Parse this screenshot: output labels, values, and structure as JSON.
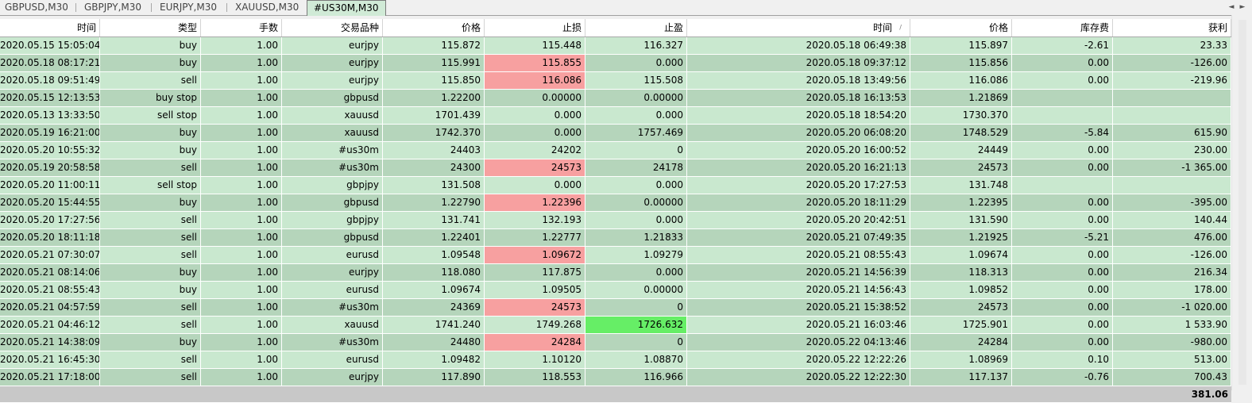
{
  "tabs": [
    {
      "label": "GBPUSD,M30",
      "active": false
    },
    {
      "label": "GBPJPY,M30",
      "active": false
    },
    {
      "label": "EURJPY,M30",
      "active": false
    },
    {
      "label": "XAUUSD,M30",
      "active": false
    },
    {
      "label": "#US30M,M30",
      "active": true
    }
  ],
  "nav": {
    "left": "◄",
    "right": "►"
  },
  "columns": [
    "时间",
    "类型",
    "手数",
    "交易品种",
    "价格",
    "止损",
    "止盈",
    "时间",
    "价格",
    "库存费",
    "获利"
  ],
  "sort_indicator": "/",
  "rows": [
    {
      "open_time": "2020.05.15 15:05:04",
      "type": "buy",
      "lots": "1.00",
      "symbol": "eurjpy",
      "price": "115.872",
      "sl": "115.448",
      "tp": "116.327",
      "close_time": "2020.05.18 06:49:38",
      "close_price": "115.897",
      "swap": "-2.61",
      "profit": "23.33"
    },
    {
      "open_time": "2020.05.18 08:17:21",
      "type": "buy",
      "lots": "1.00",
      "symbol": "eurjpy",
      "price": "115.991",
      "sl": "115.855",
      "tp": "0.000",
      "close_time": "2020.05.18 09:37:12",
      "close_price": "115.856",
      "swap": "0.00",
      "profit": "-126.00",
      "sl_hit": true
    },
    {
      "open_time": "2020.05.18 09:51:49",
      "type": "sell",
      "lots": "1.00",
      "symbol": "eurjpy",
      "price": "115.850",
      "sl": "116.086",
      "tp": "115.508",
      "close_time": "2020.05.18 13:49:56",
      "close_price": "116.086",
      "swap": "0.00",
      "profit": "-219.96",
      "sl_hit": true
    },
    {
      "open_time": "2020.05.15 12:13:53",
      "type": "buy stop",
      "lots": "1.00",
      "symbol": "gbpusd",
      "price": "1.22200",
      "sl": "0.00000",
      "tp": "0.00000",
      "close_time": "2020.05.18 16:13:53",
      "close_price": "1.21869",
      "swap": "",
      "profit": ""
    },
    {
      "open_time": "2020.05.13 13:33:50",
      "type": "sell stop",
      "lots": "1.00",
      "symbol": "xauusd",
      "price": "1701.439",
      "sl": "0.000",
      "tp": "0.000",
      "close_time": "2020.05.18 18:54:20",
      "close_price": "1730.370",
      "swap": "",
      "profit": ""
    },
    {
      "open_time": "2020.05.19 16:21:00",
      "type": "buy",
      "lots": "1.00",
      "symbol": "xauusd",
      "price": "1742.370",
      "sl": "0.000",
      "tp": "1757.469",
      "close_time": "2020.05.20 06:08:20",
      "close_price": "1748.529",
      "swap": "-5.84",
      "profit": "615.90"
    },
    {
      "open_time": "2020.05.20 10:55:32",
      "type": "buy",
      "lots": "1.00",
      "symbol": "#us30m",
      "price": "24403",
      "sl": "24202",
      "tp": "0",
      "close_time": "2020.05.20 16:00:52",
      "close_price": "24449",
      "swap": "0.00",
      "profit": "230.00"
    },
    {
      "open_time": "2020.05.19 20:58:58",
      "type": "sell",
      "lots": "1.00",
      "symbol": "#us30m",
      "price": "24300",
      "sl": "24573",
      "tp": "24178",
      "close_time": "2020.05.20 16:21:13",
      "close_price": "24573",
      "swap": "0.00",
      "profit": "-1 365.00",
      "sl_hit": true
    },
    {
      "open_time": "2020.05.20 11:00:11",
      "type": "sell stop",
      "lots": "1.00",
      "symbol": "gbpjpy",
      "price": "131.508",
      "sl": "0.000",
      "tp": "0.000",
      "close_time": "2020.05.20 17:27:53",
      "close_price": "131.748",
      "swap": "",
      "profit": ""
    },
    {
      "open_time": "2020.05.20 15:44:55",
      "type": "buy",
      "lots": "1.00",
      "symbol": "gbpusd",
      "price": "1.22790",
      "sl": "1.22396",
      "tp": "0.00000",
      "close_time": "2020.05.20 18:11:29",
      "close_price": "1.22395",
      "swap": "0.00",
      "profit": "-395.00",
      "sl_hit": true
    },
    {
      "open_time": "2020.05.20 17:27:56",
      "type": "sell",
      "lots": "1.00",
      "symbol": "gbpjpy",
      "price": "131.741",
      "sl": "132.193",
      "tp": "0.000",
      "close_time": "2020.05.20 20:42:51",
      "close_price": "131.590",
      "swap": "0.00",
      "profit": "140.44"
    },
    {
      "open_time": "2020.05.20 18:11:18",
      "type": "sell",
      "lots": "1.00",
      "symbol": "gbpusd",
      "price": "1.22401",
      "sl": "1.22777",
      "tp": "1.21833",
      "close_time": "2020.05.21 07:49:35",
      "close_price": "1.21925",
      "swap": "-5.21",
      "profit": "476.00"
    },
    {
      "open_time": "2020.05.21 07:30:07",
      "type": "sell",
      "lots": "1.00",
      "symbol": "eurusd",
      "price": "1.09548",
      "sl": "1.09672",
      "tp": "1.09279",
      "close_time": "2020.05.21 08:55:43",
      "close_price": "1.09674",
      "swap": "0.00",
      "profit": "-126.00",
      "sl_hit": true
    },
    {
      "open_time": "2020.05.21 08:14:06",
      "type": "buy",
      "lots": "1.00",
      "symbol": "eurjpy",
      "price": "118.080",
      "sl": "117.875",
      "tp": "0.000",
      "close_time": "2020.05.21 14:56:39",
      "close_price": "118.313",
      "swap": "0.00",
      "profit": "216.34"
    },
    {
      "open_time": "2020.05.21 08:55:43",
      "type": "buy",
      "lots": "1.00",
      "symbol": "eurusd",
      "price": "1.09674",
      "sl": "1.09505",
      "tp": "0.00000",
      "close_time": "2020.05.21 14:56:43",
      "close_price": "1.09852",
      "swap": "0.00",
      "profit": "178.00"
    },
    {
      "open_time": "2020.05.21 04:57:59",
      "type": "sell",
      "lots": "1.00",
      "symbol": "#us30m",
      "price": "24369",
      "sl": "24573",
      "tp": "0",
      "close_time": "2020.05.21 15:38:52",
      "close_price": "24573",
      "swap": "0.00",
      "profit": "-1 020.00",
      "sl_hit": true
    },
    {
      "open_time": "2020.05.21 04:46:12",
      "type": "sell",
      "lots": "1.00",
      "symbol": "xauusd",
      "price": "1741.240",
      "sl": "1749.268",
      "tp": "1726.632",
      "close_time": "2020.05.21 16:03:46",
      "close_price": "1725.901",
      "swap": "0.00",
      "profit": "1 533.90",
      "tp_hit": true
    },
    {
      "open_time": "2020.05.21 14:38:09",
      "type": "buy",
      "lots": "1.00",
      "symbol": "#us30m",
      "price": "24480",
      "sl": "24284",
      "tp": "0",
      "close_time": "2020.05.22 04:13:46",
      "close_price": "24284",
      "swap": "0.00",
      "profit": "-980.00",
      "sl_hit": true
    },
    {
      "open_time": "2020.05.21 16:45:30",
      "type": "sell",
      "lots": "1.00",
      "symbol": "eurusd",
      "price": "1.09482",
      "sl": "1.10120",
      "tp": "1.08870",
      "close_time": "2020.05.22 12:22:26",
      "close_price": "1.08969",
      "swap": "0.10",
      "profit": "513.00"
    },
    {
      "open_time": "2020.05.21 17:18:00",
      "type": "sell",
      "lots": "1.00",
      "symbol": "eurjpy",
      "price": "117.890",
      "sl": "118.553",
      "tp": "116.966",
      "close_time": "2020.05.22 12:22:30",
      "close_price": "117.137",
      "swap": "-0.76",
      "profit": "700.43"
    }
  ],
  "total_profit": "381.06",
  "colors": {
    "row_light": "#c9e8cf",
    "row_dark": "#b5d5bb",
    "sl_highlight": "#f7a0a0",
    "tp_highlight": "#66ee66",
    "active_tab": "#d0ead6"
  }
}
